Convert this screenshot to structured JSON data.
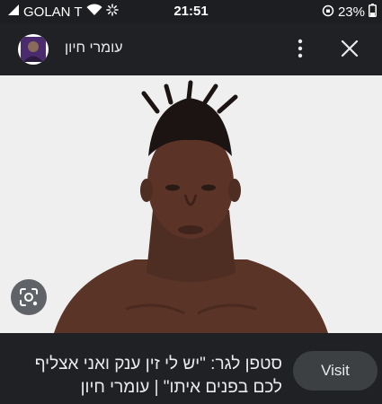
{
  "status_bar": {
    "carrier": "GOLAN T",
    "time": "21:51",
    "battery": "23%"
  },
  "header": {
    "title": "עומרי חיון"
  },
  "caption": {
    "line1": "סטפן לגר: \"יש לי זין ענק ואני אצליף",
    "line2": "לכם בפנים איתו\" | עומרי חיון"
  },
  "actions": {
    "visit_label": "Visit"
  },
  "colors": {
    "background": "#202124",
    "image_bg": "#efefef",
    "button_bg": "#3c4043"
  }
}
